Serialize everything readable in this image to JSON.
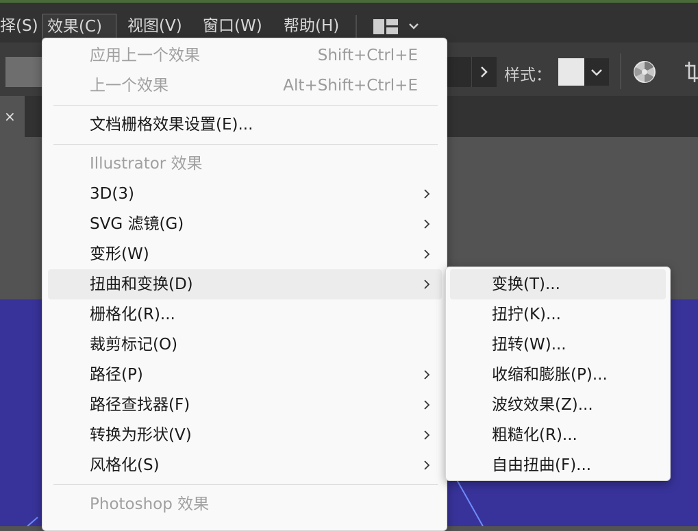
{
  "menubar": {
    "items": [
      {
        "label": "择(S)"
      },
      {
        "label": "效果(C)",
        "active": true
      },
      {
        "label": "视图(V)"
      },
      {
        "label": "窗口(W)"
      },
      {
        "label": "帮助(H)"
      }
    ],
    "workspace_icon": "layout-grid-icon",
    "workspace_chevron": "chevron-down-icon"
  },
  "controlbar": {
    "style_label": "样式：",
    "recolor_icon": "recolor-wheel-icon",
    "crop_icon": "crop-icon"
  },
  "tabbar": {
    "close_glyph": "×"
  },
  "effect_menu": {
    "items": [
      {
        "label": "应用上一个效果",
        "shortcut": "Shift+Ctrl+E",
        "disabled": true
      },
      {
        "label": "上一个效果",
        "shortcut": "Alt+Shift+Ctrl+E",
        "disabled": true
      },
      {
        "label": "文档栅格效果设置(E)..."
      },
      {
        "label": "Illustrator 效果",
        "disabled": true,
        "section": true
      },
      {
        "label": "3D(3)",
        "submenu": true
      },
      {
        "label": "SVG 滤镜(G)",
        "submenu": true
      },
      {
        "label": "变形(W)",
        "submenu": true
      },
      {
        "label": "扭曲和变换(D)",
        "submenu": true,
        "highlighted": true
      },
      {
        "label": "栅格化(R)..."
      },
      {
        "label": "裁剪标记(O)"
      },
      {
        "label": "路径(P)",
        "submenu": true
      },
      {
        "label": "路径查找器(F)",
        "submenu": true
      },
      {
        "label": "转换为形状(V)",
        "submenu": true
      },
      {
        "label": "风格化(S)",
        "submenu": true
      },
      {
        "label": "Photoshop 效果",
        "disabled": true,
        "section": true
      }
    ]
  },
  "distort_submenu": {
    "items": [
      {
        "label": "变换(T)...",
        "highlighted": true
      },
      {
        "label": "扭拧(K)..."
      },
      {
        "label": "扭转(W)..."
      },
      {
        "label": "收缩和膨胀(P)..."
      },
      {
        "label": "波纹效果(Z)..."
      },
      {
        "label": "粗糙化(R)..."
      },
      {
        "label": "自由扭曲(F)..."
      }
    ]
  },
  "colors": {
    "menubar_bg": "#323232",
    "menu_bg": "#f9f9f9",
    "canvas_blue": "#38339a",
    "hover_bg": "#ececec"
  }
}
